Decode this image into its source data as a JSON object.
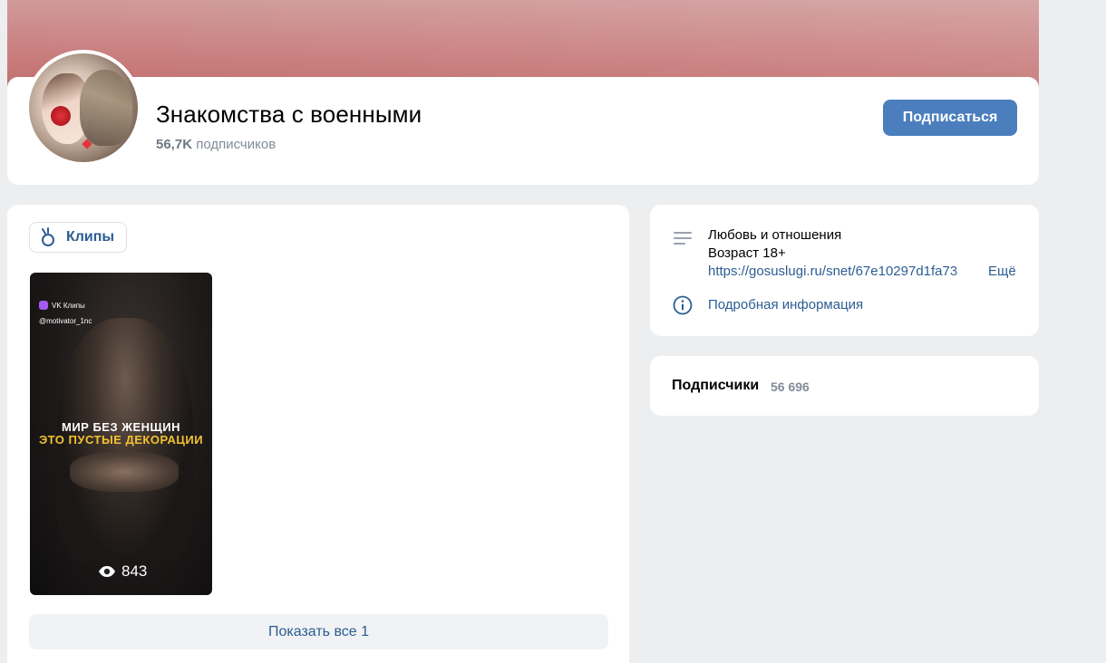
{
  "community": {
    "name": "Знакомства с военными",
    "subscribers_short": "56,7K",
    "subscribers_label": "подписчиков",
    "subscribe_button": "Подписаться"
  },
  "clips": {
    "tab_label": "Клипы",
    "items": [
      {
        "badge": "VK Клипы",
        "author": "@motivator_1nc",
        "caption_line1": "МИР БЕЗ ЖЕНЩИН",
        "caption_line2": "ЭТО ПУСТЫЕ ДЕКОРАЦИИ",
        "views": "843"
      }
    ],
    "show_all": "Показать все 1"
  },
  "info": {
    "category": "Любовь и отношения",
    "age": "Возраст 18+",
    "link": "https://gosuslugi.ru/snet/67e10297d1fa73",
    "more": "Ещё",
    "details": "Подробная информация"
  },
  "followers": {
    "title": "Подписчики",
    "count": "56 696"
  },
  "colors": {
    "accent": "#4b7ebd",
    "link": "#2c5d93",
    "background": "#edeef0",
    "secondary_text": "#818c99",
    "cover": "#c97d7d",
    "clip_caption_highlight": "#f2c230"
  }
}
